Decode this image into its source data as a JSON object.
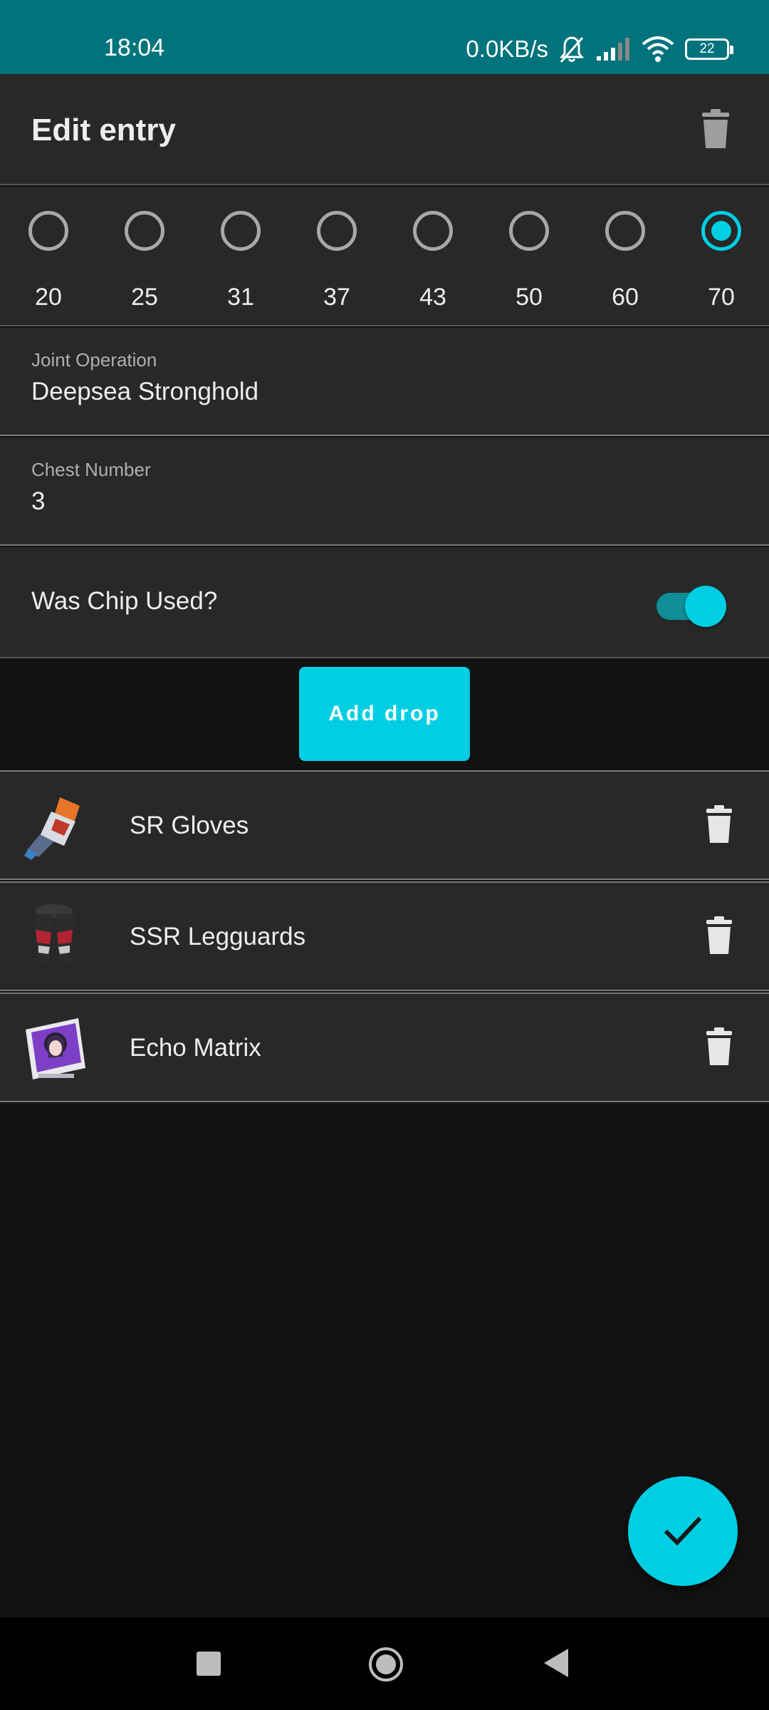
{
  "status_bar": {
    "time": "18:04",
    "network_speed": "0.0KB/s",
    "battery": "22",
    "icons": [
      "bell-off-icon",
      "signal-icon",
      "wifi-icon",
      "battery-icon"
    ]
  },
  "app_bar": {
    "title": "Edit entry",
    "delete_icon": "trash-icon"
  },
  "level_options": [
    {
      "label": "20",
      "selected": false
    },
    {
      "label": "25",
      "selected": false
    },
    {
      "label": "31",
      "selected": false
    },
    {
      "label": "37",
      "selected": false
    },
    {
      "label": "43",
      "selected": false
    },
    {
      "label": "50",
      "selected": false
    },
    {
      "label": "60",
      "selected": false
    },
    {
      "label": "70",
      "selected": true
    }
  ],
  "fields": {
    "joint_operation": {
      "label": "Joint Operation",
      "value": "Deepsea Stronghold"
    },
    "chest_number": {
      "label": "Chest Number",
      "value": "3"
    }
  },
  "chip_switch": {
    "label": "Was Chip Used?",
    "on": true
  },
  "add_drop_label": "Add drop",
  "drops": [
    {
      "name": "SR Gloves",
      "icon": "gloves-icon"
    },
    {
      "name": "SSR Legguards",
      "icon": "legguards-icon"
    },
    {
      "name": "Echo Matrix",
      "icon": "matrix-card-icon"
    }
  ],
  "fab_icon": "check-icon",
  "colors": {
    "accent": "#00CFE3",
    "status_bar": "#00737C",
    "surface": "#282828",
    "background": "#121212"
  }
}
